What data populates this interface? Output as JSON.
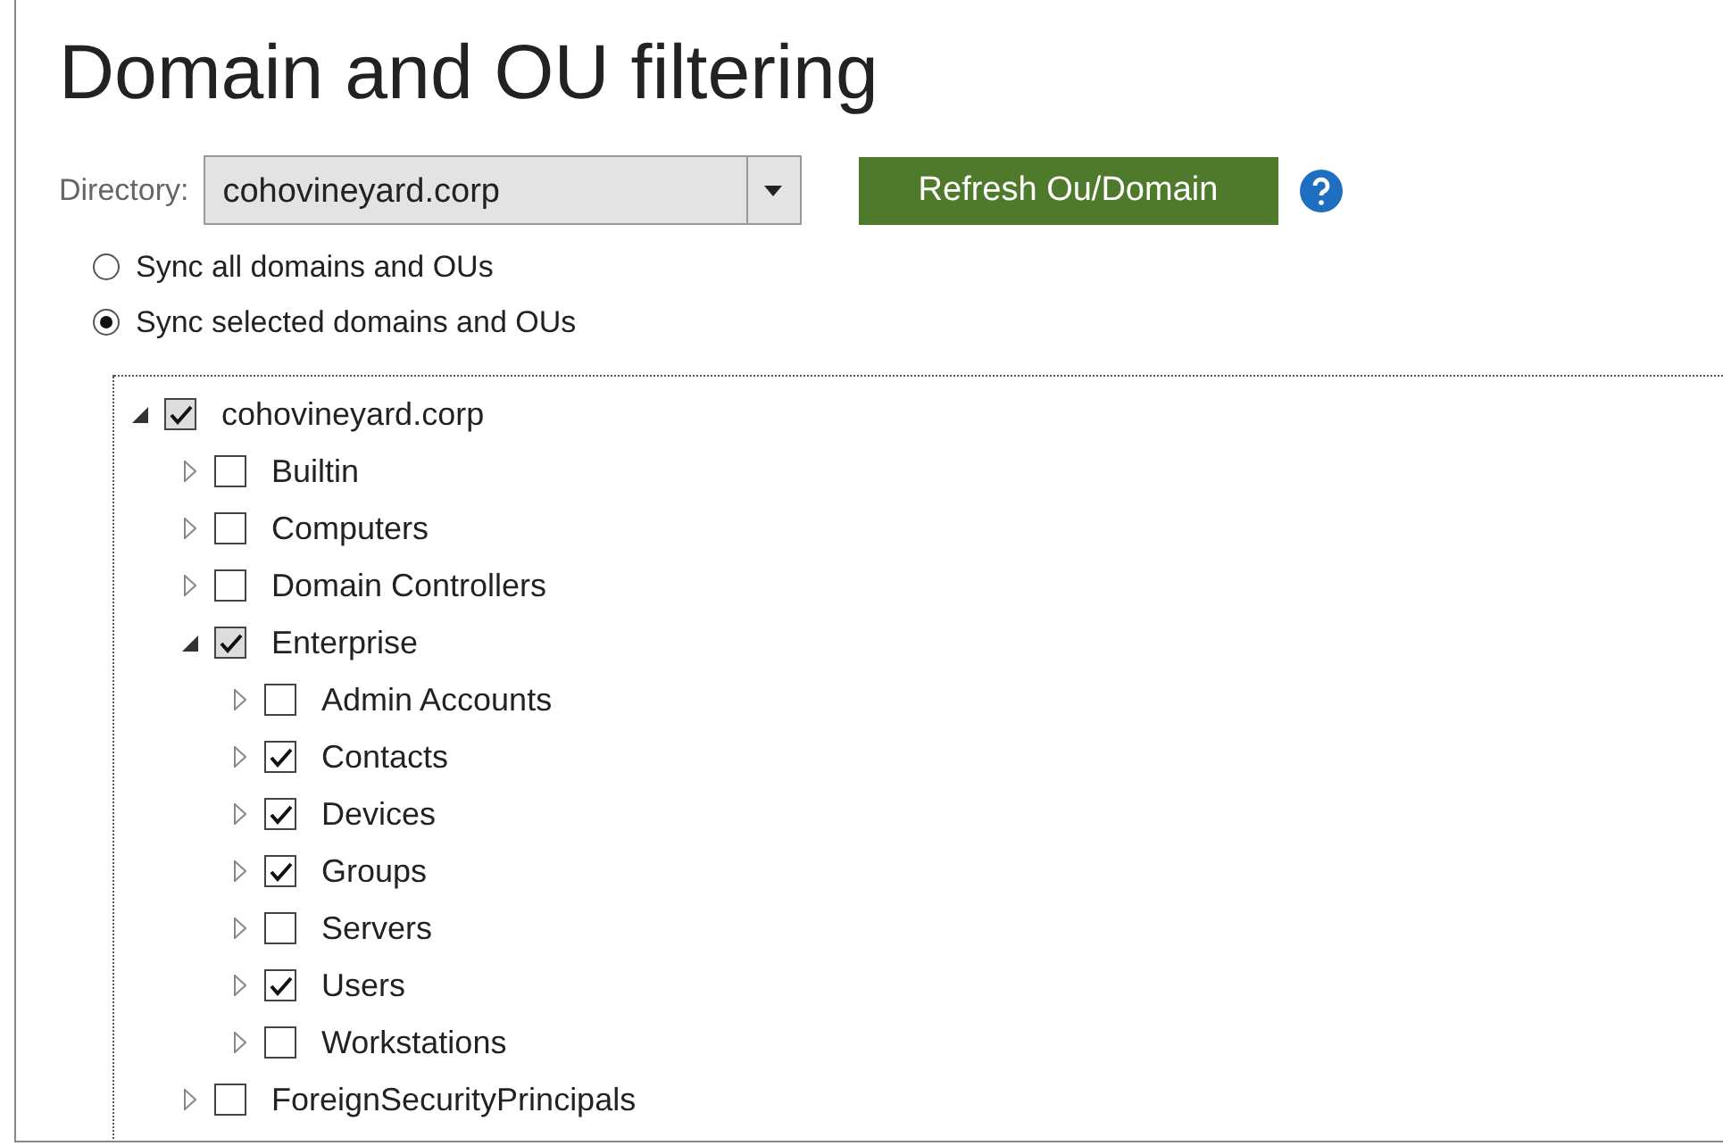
{
  "title": "Domain and OU filtering",
  "directory": {
    "label": "Directory:",
    "value": "cohovineyard.corp"
  },
  "refresh_button": "Refresh Ou/Domain",
  "sync_options": [
    {
      "label": "Sync all domains and OUs",
      "selected": false
    },
    {
      "label": "Sync selected domains and OUs",
      "selected": true
    }
  ],
  "tree": [
    {
      "label": "cohovineyard.corp",
      "expanded": true,
      "checked": true,
      "partial": true,
      "children": [
        {
          "label": "Builtin",
          "expanded": false,
          "checked": false,
          "partial": false
        },
        {
          "label": "Computers",
          "expanded": false,
          "checked": false,
          "partial": false
        },
        {
          "label": "Domain Controllers",
          "expanded": false,
          "checked": false,
          "partial": false
        },
        {
          "label": "Enterprise",
          "expanded": true,
          "checked": true,
          "partial": true,
          "children": [
            {
              "label": "Admin Accounts",
              "expanded": false,
              "checked": false,
              "partial": false
            },
            {
              "label": "Contacts",
              "expanded": false,
              "checked": true,
              "partial": false
            },
            {
              "label": "Devices",
              "expanded": false,
              "checked": true,
              "partial": false
            },
            {
              "label": "Groups",
              "expanded": false,
              "checked": true,
              "partial": false
            },
            {
              "label": "Servers",
              "expanded": false,
              "checked": false,
              "partial": false
            },
            {
              "label": "Users",
              "expanded": false,
              "checked": true,
              "partial": false
            },
            {
              "label": "Workstations",
              "expanded": false,
              "checked": false,
              "partial": false
            }
          ]
        },
        {
          "label": "ForeignSecurityPrincipals",
          "expanded": false,
          "checked": false,
          "partial": false
        }
      ]
    }
  ]
}
